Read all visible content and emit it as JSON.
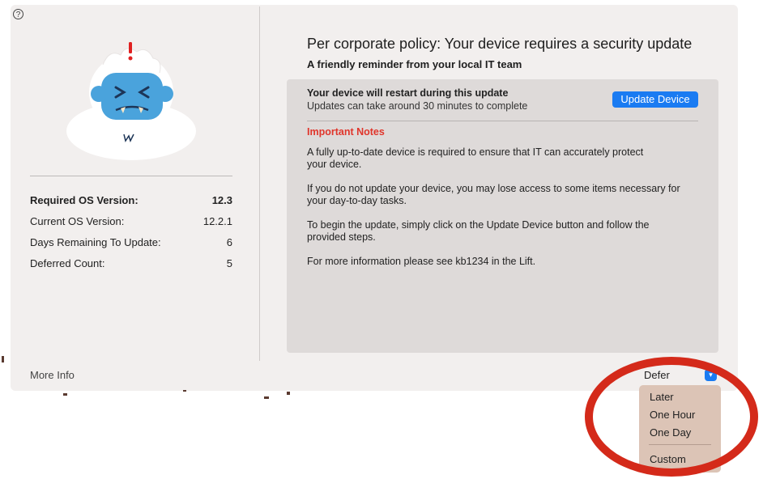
{
  "window": {
    "help_glyph": "?"
  },
  "sidebar": {
    "rows": [
      {
        "label": "Required OS Version:",
        "value": "12.3"
      },
      {
        "label": "Current OS Version:",
        "value": "12.2.1"
      },
      {
        "label": "Days Remaining To Update:",
        "value": "6"
      },
      {
        "label": "Deferred Count:",
        "value": "5"
      }
    ],
    "more_info": "More Info"
  },
  "main": {
    "title": "Per corporate policy: Your device requires a security update",
    "subtitle": "A friendly reminder from your local IT team",
    "panel": {
      "restart_title": "Your device will restart during this update",
      "restart_sub": "Updates can take around 30 minutes to complete",
      "update_button": "Update Device",
      "notes_heading": "Important Notes",
      "notes": [
        [
          "A fully up-to-date device is required to ensure that IT can accurately protect",
          "your device."
        ],
        [
          "If you do not update your device, you may lose access to some items necessary for",
          "your day-to-day tasks."
        ],
        [
          "To begin the update, simply click on the Update Device button and follow the",
          "provided steps."
        ],
        [
          "For more information please see kb1234 in the Lift."
        ]
      ]
    }
  },
  "defer": {
    "selected": "Defer",
    "options": [
      "Later",
      "One Hour",
      "One Day",
      "Custom"
    ]
  },
  "colors": {
    "accent": "#1a7bf2",
    "important": "#e0352b",
    "annotation": "#d42a1a"
  }
}
